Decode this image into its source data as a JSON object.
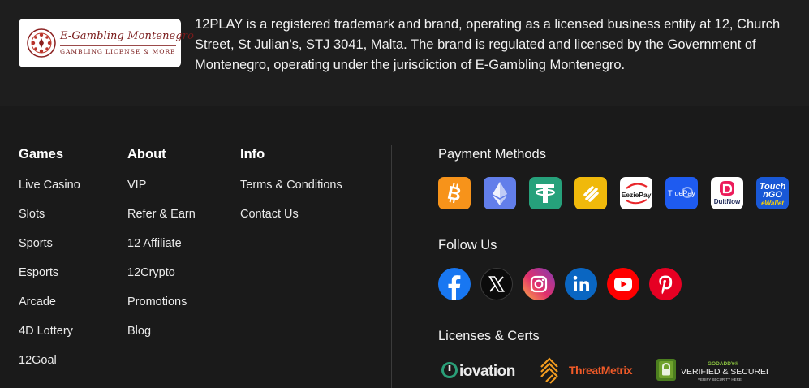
{
  "license_badge": {
    "line1": "E-Gambling Montenegro",
    "line2": "GAMBLING LICENSE & MORE"
  },
  "license_text": "12PLAY is a registered trademark and brand, operating as a licensed business entity at 12, Church Street, St Julian's, STJ 3041, Malta. The brand is regulated and licensed by the Government of Montenegro, operating under the jurisdiction of E-Gambling Montenegro.",
  "footer": {
    "games": {
      "title": "Games",
      "links": [
        "Live Casino",
        "Slots",
        "Sports",
        "Esports",
        "Arcade",
        "4D Lottery",
        "12Goal"
      ]
    },
    "about": {
      "title": "About",
      "links": [
        "VIP",
        "Refer & Earn",
        "12 Affiliate",
        "12Crypto",
        "Promotions",
        "Blog"
      ]
    },
    "info": {
      "title": "Info",
      "links": [
        "Terms & Conditions",
        "Contact Us"
      ]
    }
  },
  "payment": {
    "title": "Payment Methods",
    "methods": [
      {
        "icon": "bitcoin-icon",
        "color": "#f7931a"
      },
      {
        "icon": "ethereum-icon",
        "color": "#627eea"
      },
      {
        "icon": "tether-icon",
        "color": "#26a17b"
      },
      {
        "icon": "binance-pay-icon",
        "color": "#f0b90b"
      },
      {
        "icon": "eeziepay-icon",
        "label": "EeziePay",
        "color": "#ffffff"
      },
      {
        "icon": "truepay-icon",
        "label": "TruePay",
        "color": "#1e5bf0"
      },
      {
        "icon": "duitnow-icon",
        "label": "DuitNow",
        "color": "#ffffff"
      },
      {
        "icon": "touch-n-go-icon",
        "label_top": "Touch",
        "label_mid": "nGO",
        "label_bottom": "eWallet",
        "color": "#1958d6"
      }
    ]
  },
  "follow": {
    "title": "Follow Us",
    "networks": [
      {
        "icon": "facebook-icon",
        "color": "#1877f2"
      },
      {
        "icon": "x-twitter-icon",
        "color": "#000000"
      },
      {
        "icon": "instagram-icon",
        "color": "#d6249f"
      },
      {
        "icon": "linkedin-icon",
        "color": "#0a66c2"
      },
      {
        "icon": "youtube-icon",
        "color": "#ff0000"
      },
      {
        "icon": "pinterest-icon",
        "color": "#e60023"
      }
    ]
  },
  "licenses": {
    "title": "Licenses & Certs",
    "iovation": "iovation",
    "threatmetrix": "ThreatMetrix",
    "godaddy_top": "GODADDY®",
    "godaddy_main": "VERIFIED & SECURED",
    "godaddy_sub": "VERIFY SECURITY HERE"
  }
}
